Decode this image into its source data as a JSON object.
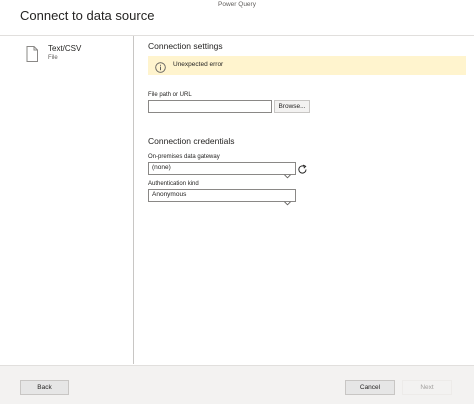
{
  "window": {
    "title": "Power Query"
  },
  "header": {
    "title": "Connect to data source"
  },
  "sidebar": {
    "source": {
      "name": "Text/CSV",
      "type": "File"
    }
  },
  "settings": {
    "section_title": "Connection settings",
    "error": "Unexpected error",
    "file_path_label": "File path or URL",
    "file_path_value": "",
    "browse_label": "Browse..."
  },
  "credentials": {
    "section_title": "Connection credentials",
    "gateway_label": "On-premises data gateway",
    "gateway_value": "(none)",
    "auth_label": "Authentication kind",
    "auth_value": "Anonymous"
  },
  "footer": {
    "back_label": "Back",
    "cancel_label": "Cancel",
    "next_label": "Next"
  },
  "colors": {
    "error_banner_bg": "#fff4ce",
    "footer_bg": "#f3f2f1",
    "border": "#8a8886"
  },
  "icons": {
    "source": "file-icon",
    "error": "info-icon",
    "dropdown": "chevron-down-icon",
    "refresh": "refresh-icon"
  }
}
